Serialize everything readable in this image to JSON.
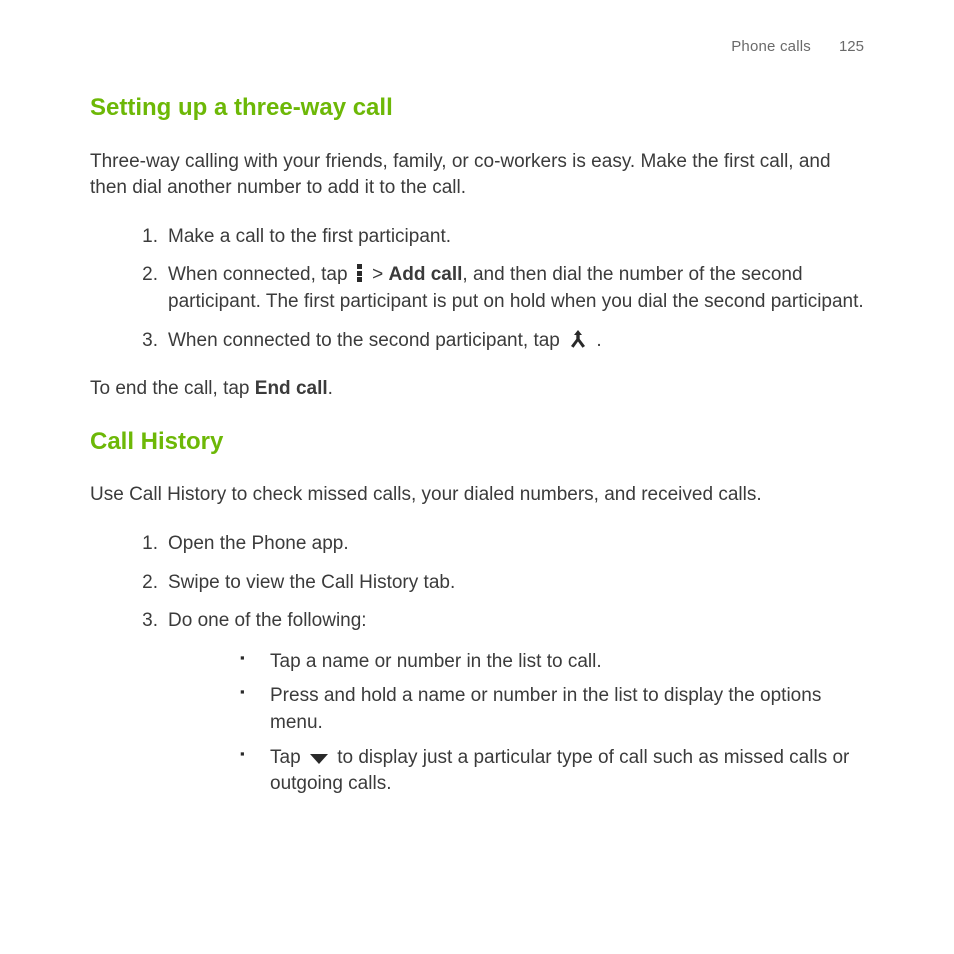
{
  "header": {
    "section": "Phone calls",
    "pageNumber": "125"
  },
  "s1": {
    "title": "Setting up a three-way call",
    "intro": "Three-way calling with your friends, family, or co-workers is easy. Make the first call, and then dial another number to add it to the call.",
    "step1": "Make a call to the first participant.",
    "step2a": "When connected, tap ",
    "step2_gt": " > ",
    "step2_bold": "Add call",
    "step2b": ", and then dial the number of the second participant. The first participant is put on hold when you dial the second participant.",
    "step3a": "When connected to the second participant, tap ",
    "step3b": " .",
    "closerA": "To end the call, tap ",
    "closerBold": "End call",
    "closerB": "."
  },
  "s2": {
    "title": "Call History",
    "intro": "Use Call History to check missed calls, your dialed numbers, and received calls.",
    "step1": "Open the Phone app.",
    "step2": "Swipe to view the Call History tab.",
    "step3": "Do one of the following:",
    "b1": "Tap a name or number in the list to call.",
    "b2": "Press and hold a name or number in the list to display the options menu.",
    "b3a": "Tap ",
    "b3b": " to display just a particular type of call such as missed calls or outgoing calls."
  },
  "nums": {
    "n1": "1.",
    "n2": "2.",
    "n3": "3."
  }
}
